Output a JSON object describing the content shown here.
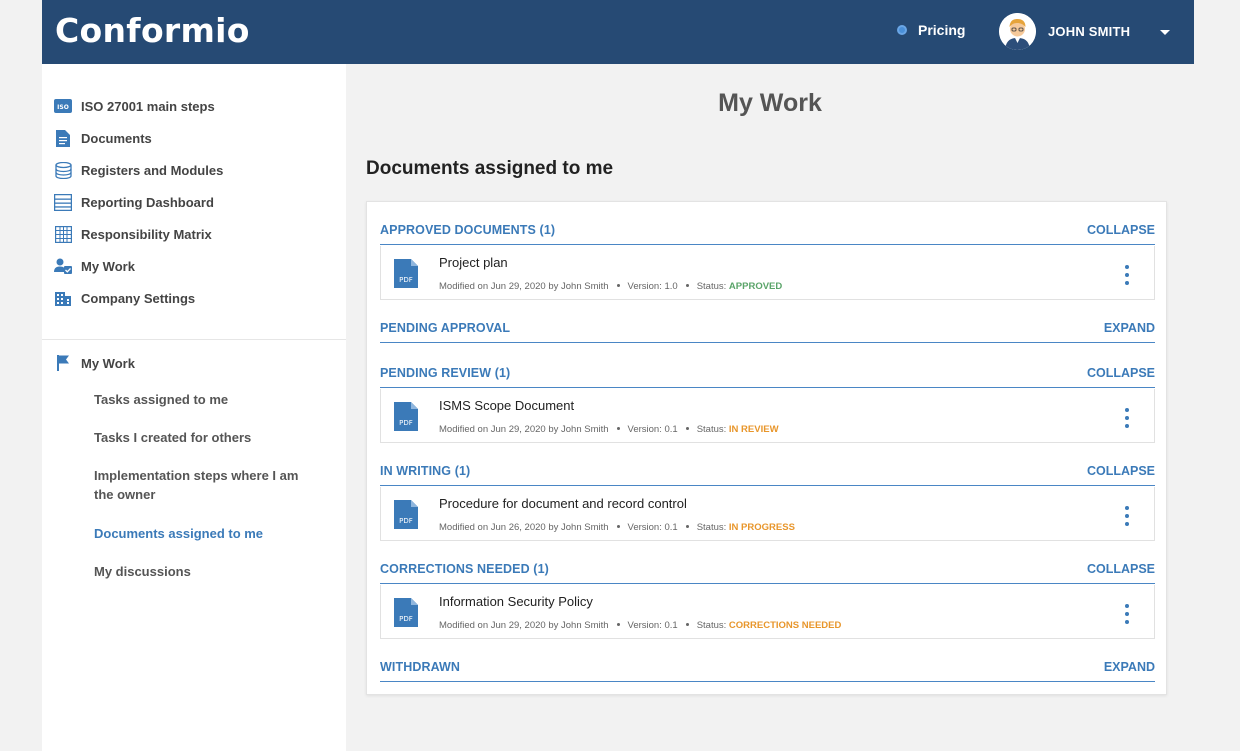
{
  "header": {
    "logo": "Conformio",
    "pricing_label": "Pricing",
    "user_name": "JOHN SMITH"
  },
  "sidebar": {
    "items": [
      {
        "label": "ISO 27001 main steps",
        "icon": "iso-icon"
      },
      {
        "label": "Documents",
        "icon": "document-icon"
      },
      {
        "label": "Registers and Modules",
        "icon": "database-icon"
      },
      {
        "label": "Reporting Dashboard",
        "icon": "dashboard-icon"
      },
      {
        "label": "Responsibility Matrix",
        "icon": "grid-icon"
      },
      {
        "label": "My Work",
        "icon": "user-check-icon"
      },
      {
        "label": "Company Settings",
        "icon": "building-icon"
      }
    ],
    "section_label": "My Work",
    "section_icon": "flag-icon",
    "sub_items": [
      {
        "label": "Tasks assigned to me"
      },
      {
        "label": "Tasks I created for others"
      },
      {
        "label": "Implementation steps where I am the owner"
      },
      {
        "label": "Documents assigned to me"
      },
      {
        "label": "My discussions"
      }
    ]
  },
  "main": {
    "page_title": "My Work",
    "section_title": "Documents assigned to me",
    "groups": [
      {
        "title": "APPROVED DOCUMENTS (1)",
        "toggle": "COLLAPSE"
      },
      {
        "title": "PENDING APPROVAL",
        "toggle": "EXPAND"
      },
      {
        "title": "PENDING REVIEW (1)",
        "toggle": "COLLAPSE"
      },
      {
        "title": "IN WRITING (1)",
        "toggle": "COLLAPSE"
      },
      {
        "title": "CORRECTIONS NEEDED (1)",
        "toggle": "COLLAPSE"
      },
      {
        "title": "WITHDRAWN",
        "toggle": "EXPAND"
      }
    ],
    "documents": [
      {
        "name": "Project plan",
        "modified": "Modified on Jun 29, 2020 by John Smith",
        "version": "Version: 1.0",
        "status_label": "Status:",
        "status": "APPROVED",
        "pdf_label": "PDF"
      },
      {
        "name": "ISMS Scope Document",
        "modified": "Modified on Jun 29, 2020 by John Smith",
        "version": "Version: 0.1",
        "status_label": "Status:",
        "status": "IN REVIEW",
        "pdf_label": "PDF"
      },
      {
        "name": "Procedure for document and record control",
        "modified": "Modified on Jun 26, 2020 by John Smith",
        "version": "Version: 0.1",
        "status_label": "Status:",
        "status": "IN PROGRESS",
        "pdf_label": "PDF"
      },
      {
        "name": "Information Security Policy",
        "modified": "Modified on Jun 29, 2020 by John Smith",
        "version": "Version: 0.1",
        "status_label": "Status:",
        "status": "CORRECTIONS NEEDED",
        "pdf_label": "PDF"
      }
    ]
  },
  "colors": {
    "header_bg": "#264a74",
    "accent": "#3b7ab8",
    "approved": "#5aa469",
    "warning": "#e8962b"
  }
}
